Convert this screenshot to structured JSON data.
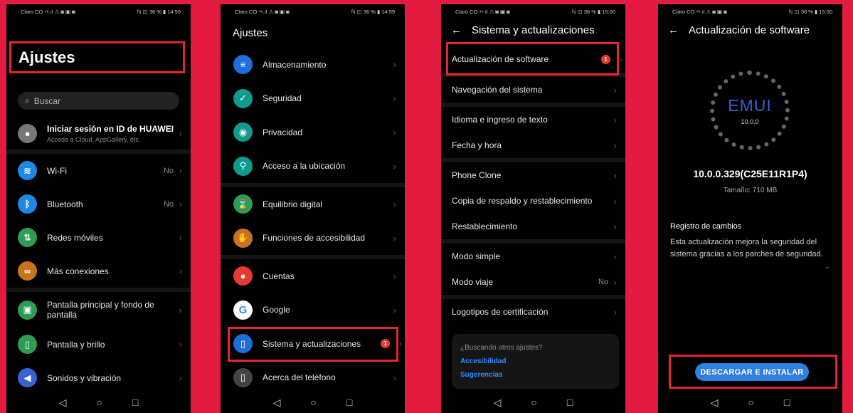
{
  "phone1": {
    "status": {
      "left": "Claro CO ⁴⁶.ıl ⚠ ◙ ▣ ◙",
      "right": "ℕ ◫ 36 % ▮ 14:59"
    },
    "title": "Ajustes",
    "search_placeholder": "Buscar",
    "account": {
      "title": "Iniciar sesión en ID de HUAWEI",
      "subtitle": "Acceda a Cloud, AppGallery, etc."
    },
    "items": [
      {
        "label": "Wi-Fi",
        "value": "No",
        "icon": "wifi-icon",
        "color": "#1e88e5"
      },
      {
        "label": "Bluetooth",
        "value": "No",
        "icon": "bluetooth-icon",
        "color": "#1e88e5"
      },
      {
        "label": "Redes móviles",
        "value": "",
        "icon": "mobile-data-icon",
        "color": "#2e9d52"
      },
      {
        "label": "Más conexiones",
        "value": "",
        "icon": "link-icon",
        "color": "#c8741f"
      },
      {
        "label": "Pantalla principal y fondo de pantalla",
        "value": "",
        "icon": "wallpaper-icon",
        "color": "#2e9d52"
      },
      {
        "label": "Pantalla y brillo",
        "value": "",
        "icon": "phone-brightness-icon",
        "color": "#2e9d52"
      },
      {
        "label": "Sonidos y vibración",
        "value": "",
        "icon": "sound-icon",
        "color": "#3a63d1"
      }
    ]
  },
  "phone2": {
    "status": {
      "left": "Claro CO ⁴⁶.ıl ⚠ ◙ ▣ ◙",
      "right": "ℕ ◫ 36 % ▮ 14:59"
    },
    "title": "Ajustes",
    "items": [
      {
        "label": "Almacenamiento",
        "icon": "storage-icon",
        "color": "#1e6fd9"
      },
      {
        "label": "Seguridad",
        "icon": "shield-icon",
        "color": "#0f9b8e"
      },
      {
        "label": "Privacidad",
        "icon": "privacy-icon",
        "color": "#0f9b8e"
      },
      {
        "label": "Acceso a la ubicación",
        "icon": "location-icon",
        "color": "#0f9b8e"
      },
      {
        "label": "Equilibrio digital",
        "icon": "hourglass-icon",
        "color": "#2e9d52"
      },
      {
        "label": "Funciones de accesibilidad",
        "icon": "hand-icon",
        "color": "#c8741f"
      },
      {
        "label": "Cuentas",
        "icon": "account-icon",
        "color": "#e53935"
      },
      {
        "label": "Google",
        "icon": "google-icon",
        "color": "#ffffff"
      },
      {
        "label": "Sistema y actualizaciones",
        "icon": "system-update-icon",
        "color": "#1e6fd9",
        "badge": "1"
      },
      {
        "label": "Acerca del teléfono",
        "icon": "about-phone-icon",
        "color": "#444444"
      }
    ]
  },
  "phone3": {
    "status": {
      "left": "Claro CO ⁴⁶.ıl ⚠ ◙ ▣ ◙",
      "right": "ℕ ◫ 36 % ▮ 15:00"
    },
    "title": "Sistema y actualizaciones",
    "items": [
      {
        "label": "Actualización de software",
        "badge": "1"
      },
      {
        "label": "Navegación del sistema"
      },
      {
        "label": "Idioma e ingreso de texto"
      },
      {
        "label": "Fecha y hora"
      },
      {
        "label": "Phone Clone"
      },
      {
        "label": "Copia de respaldo y restablecimiento"
      },
      {
        "label": "Restablecimiento"
      },
      {
        "label": "Modo simple"
      },
      {
        "label": "Modo viaje",
        "value": "No"
      },
      {
        "label": "Logotipos de certificación"
      }
    ],
    "tip": {
      "question": "¿Buscando otros ajustes?",
      "link1": "Accesibilidad",
      "link2": "Sugerencias"
    }
  },
  "phone4": {
    "status": {
      "left": "Claro CO ⁴⁶.ıl ⚠ ◙ ▣ ◙",
      "right": "ℕ ◫ 36 % ▮ 15:00"
    },
    "title": "Actualización de software",
    "logo": "EMUI",
    "logo_version": "10.0.0",
    "version": "10.0.0.329(C25E11R1P4)",
    "size": "Tamaño: 710 MB",
    "changelog_title": "Registro de cambios",
    "changelog_text": "Esta actualización mejora la seguridad del sistema gracias a los parches de seguridad.",
    "button": "DESCARGAR E INSTALAR"
  }
}
